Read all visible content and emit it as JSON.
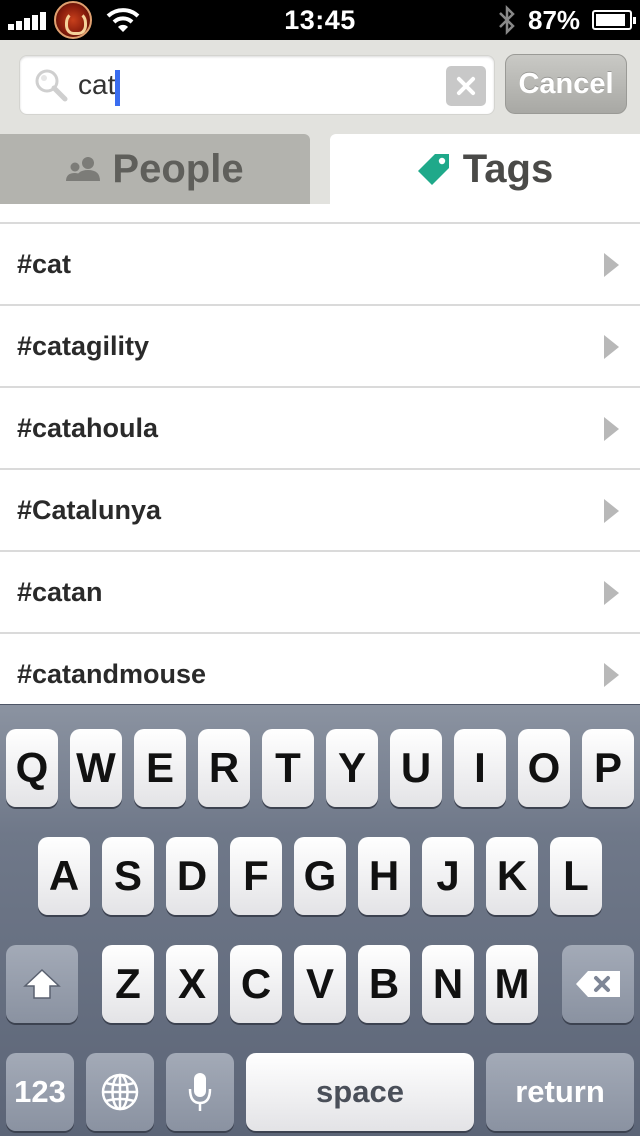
{
  "status_bar": {
    "time": "13:45",
    "battery": "87%"
  },
  "search": {
    "query": "cat",
    "cancel_label": "Cancel"
  },
  "tabs": [
    {
      "label": "People",
      "icon": "people-icon",
      "selected": false
    },
    {
      "label": "Tags",
      "icon": "tag-icon",
      "selected": true
    }
  ],
  "tag_results": [
    {
      "label": "#cat"
    },
    {
      "label": "#catagility"
    },
    {
      "label": "#catahoula"
    },
    {
      "label": "#Catalunya"
    },
    {
      "label": "#catan"
    },
    {
      "label": "#catandmouse"
    }
  ],
  "keyboard": {
    "row1": [
      "Q",
      "W",
      "E",
      "R",
      "T",
      "Y",
      "U",
      "I",
      "O",
      "P"
    ],
    "row2": [
      "A",
      "S",
      "D",
      "F",
      "G",
      "H",
      "J",
      "K",
      "L"
    ],
    "row3": [
      "Z",
      "X",
      "C",
      "V",
      "B",
      "N",
      "M"
    ],
    "numbers_label": "123",
    "space_label": "space",
    "return_label": "return"
  },
  "colors": {
    "accent_tag": "#1fa98a",
    "cursor": "#3a6df0"
  }
}
